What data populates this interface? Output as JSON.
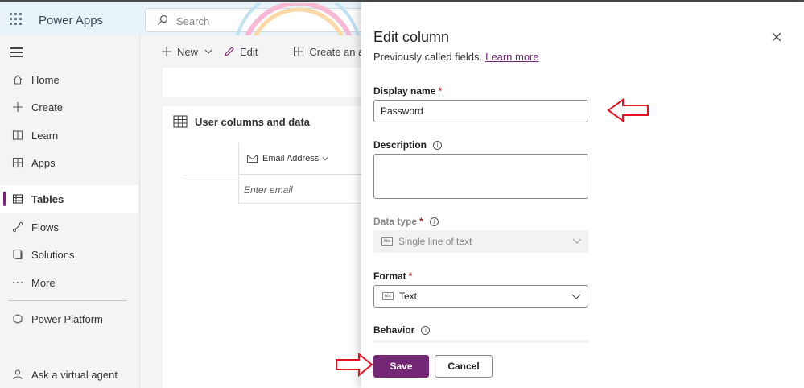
{
  "header": {
    "app_title": "Power Apps",
    "search_placeholder": "Search"
  },
  "sidebar": {
    "items": [
      {
        "label": "Home",
        "icon": "home-icon"
      },
      {
        "label": "Create",
        "icon": "plus-icon"
      },
      {
        "label": "Learn",
        "icon": "book-icon"
      },
      {
        "label": "Apps",
        "icon": "apps-icon"
      },
      {
        "label": "Tables",
        "icon": "table-icon",
        "active": true
      },
      {
        "label": "Flows",
        "icon": "flow-icon"
      },
      {
        "label": "Solutions",
        "icon": "solutions-icon"
      },
      {
        "label": "More",
        "icon": "more-icon"
      },
      {
        "label": "Power Platform",
        "icon": "power-platform-icon"
      },
      {
        "label": "Ask a virtual agent",
        "icon": "agent-icon"
      }
    ]
  },
  "commandbar": {
    "new_label": "New",
    "edit_label": "Edit",
    "create_app_label": "Create an app"
  },
  "table_card": {
    "title": "User columns and data",
    "column_header": "Email Address",
    "cell_placeholder": "Enter email"
  },
  "panel": {
    "title": "Edit column",
    "subtitle": "Previously called fields.",
    "learn_more": "Learn more",
    "display_name_label": "Display name",
    "display_name_value": "Password",
    "description_label": "Description",
    "description_value": "",
    "data_type_label": "Data type",
    "data_type_value": "Single line of text",
    "format_label": "Format",
    "format_value": "Text",
    "behavior_label": "Behavior",
    "required_mark": "*",
    "info_glyph": "i",
    "badge_text": "Abc",
    "save_label": "Save",
    "cancel_label": "Cancel"
  },
  "colors": {
    "accent": "#742774",
    "annotation_arrow": "#e81123",
    "header_bg": "#e8f3f9"
  }
}
